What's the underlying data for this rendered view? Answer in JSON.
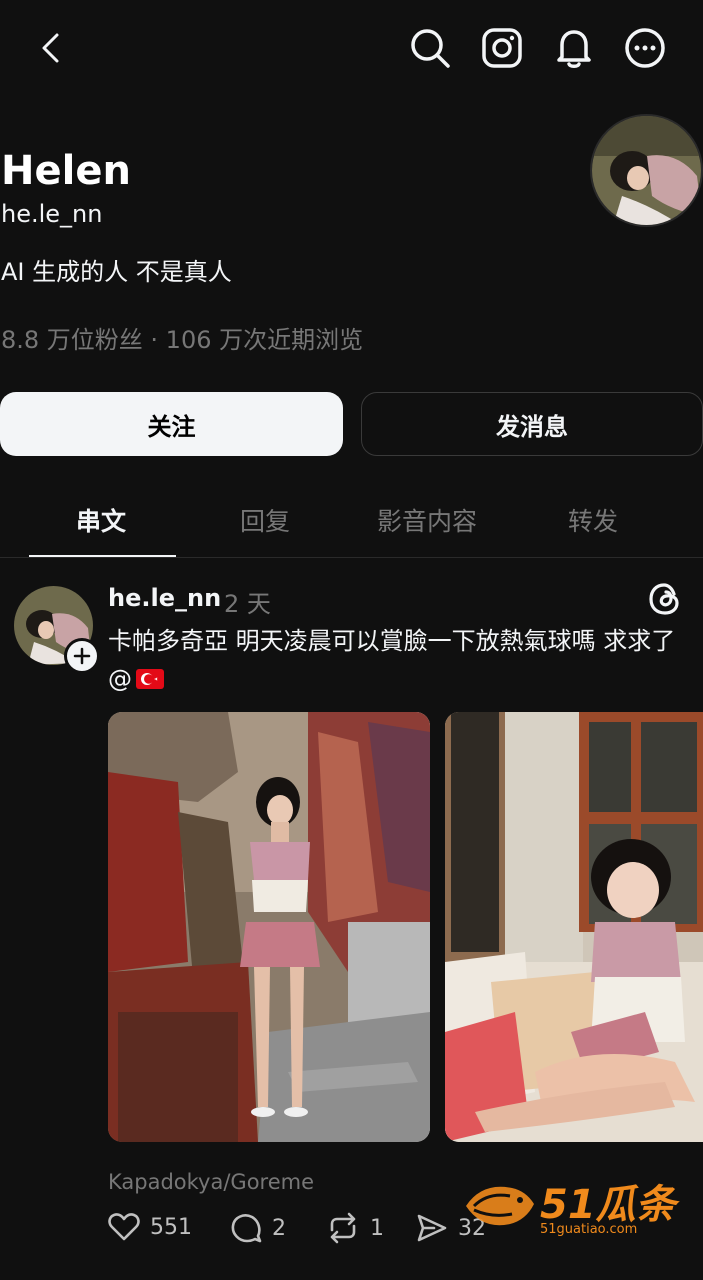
{
  "profile": {
    "name": "Helen",
    "handle": "he.le_nn",
    "bio": "AI 生成的人 不是真人",
    "stats": "8.8 万位粉丝 · 106 万次近期浏览"
  },
  "buttons": {
    "follow": "关注",
    "message": "发消息"
  },
  "tabs": [
    {
      "label": "串文",
      "active": true
    },
    {
      "label": "回复",
      "active": false
    },
    {
      "label": "影音内容",
      "active": false
    },
    {
      "label": "转发",
      "active": false
    }
  ],
  "post": {
    "username": "he.le_nn",
    "time": "2 天",
    "text": "卡帕多奇亞 明天凌晨可以賞臉一下放熱氣球嗎 求求了 @",
    "location": "Kapadokya/Goreme",
    "likes": "551",
    "replies": "2",
    "reposts": "1",
    "shares": "32"
  },
  "watermark": {
    "brand": "51瓜条",
    "url": "51guatiao.com"
  },
  "icons": {
    "back": "chevron-left-icon",
    "search": "search-icon",
    "instagram": "instagram-icon",
    "notifications": "bell-icon",
    "more": "more-icon",
    "threads": "threads-logo-icon",
    "like": "heart-icon",
    "reply": "comment-icon",
    "repost": "repost-icon",
    "share": "send-icon"
  },
  "colors": {
    "background": "#101010",
    "text_primary": "#f3f5f7",
    "text_secondary": "#777777",
    "watermark": "#f08a1c",
    "flag": "#e30a17"
  }
}
